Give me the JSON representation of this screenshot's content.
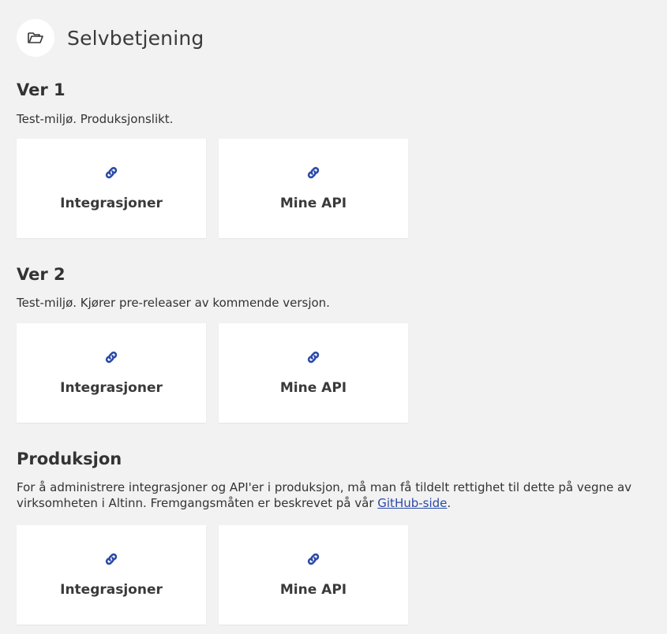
{
  "header": {
    "title": "Selvbetjening",
    "icon": "folder-open-icon"
  },
  "sections": [
    {
      "title": "Ver 1",
      "description": "Test-miljø. Produksjonslikt.",
      "cards": [
        {
          "label": "Integrasjoner",
          "icon": "link-icon"
        },
        {
          "label": "Mine API",
          "icon": "link-icon"
        }
      ]
    },
    {
      "title": "Ver 2",
      "description": "Test-miljø. Kjører pre-releaser av kommende versjon.",
      "cards": [
        {
          "label": "Integrasjoner",
          "icon": "link-icon"
        },
        {
          "label": "Mine API",
          "icon": "link-icon"
        }
      ]
    },
    {
      "title": "Produksjon",
      "description_before": "For å administrere integrasjoner og API'er i produksjon, må man få tildelt rettighet til dette på vegne av virksomheten i Altinn. Fremgangsmåten er beskrevet på vår ",
      "description_link": "GitHub-side",
      "description_after": ".",
      "cards": [
        {
          "label": "Integrasjoner",
          "icon": "link-icon"
        },
        {
          "label": "Mine API",
          "icon": "link-icon"
        }
      ]
    }
  ],
  "colors": {
    "background": "#f2f2f2",
    "card": "#ffffff",
    "icon_accent": "#2b4aa8",
    "link": "#2b4aa8"
  }
}
